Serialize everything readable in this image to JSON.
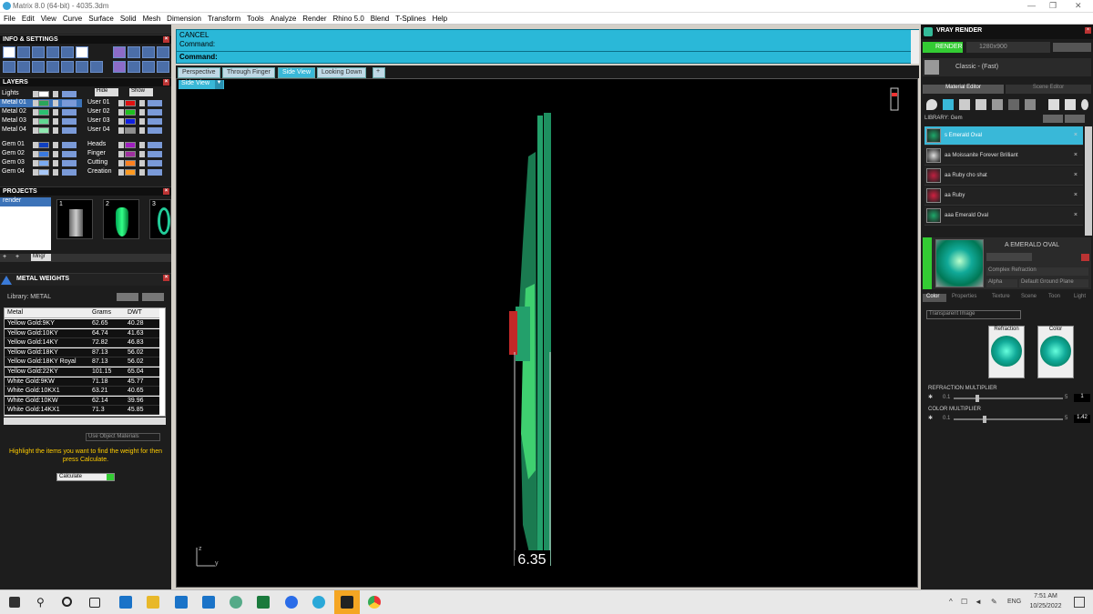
{
  "window": {
    "title": "Matrix 8.0 (64-bit) - 4035.3dm"
  },
  "menu": [
    "File",
    "Edit",
    "View",
    "Curve",
    "Surface",
    "Solid",
    "Mesh",
    "Dimension",
    "Transform",
    "Tools",
    "Analyze",
    "Render",
    "Rhino 5.0",
    "Blend",
    "T-Splines",
    "Help"
  ],
  "left": {
    "info_title": "INFO & SETTINGS",
    "layers_title": "LAYERS",
    "hide_label": "Hide",
    "show_label": "Show",
    "layers_left": [
      {
        "name": "Lights",
        "color": "#ffffff"
      },
      {
        "name": "Metal 01",
        "color": "#2aa55a",
        "selected": true
      },
      {
        "name": "Metal 02",
        "color": "#2ac070"
      },
      {
        "name": "Metal 03",
        "color": "#5fd890"
      },
      {
        "name": "Metal 04",
        "color": "#8fe8b0"
      },
      {
        "name": "Gem 01",
        "color": "#1040c0"
      },
      {
        "name": "Gem 02",
        "color": "#3a7ae0"
      },
      {
        "name": "Gem 03",
        "color": "#7aaaf0"
      },
      {
        "name": "Gem 04",
        "color": "#a8c8f8"
      }
    ],
    "layers_right": [
      {
        "name": "User 01",
        "color": "#e01010"
      },
      {
        "name": "User 02",
        "color": "#20c020"
      },
      {
        "name": "User 03",
        "color": "#1020e0"
      },
      {
        "name": "User 04",
        "color": "#909090"
      },
      {
        "name": "Heads",
        "color": "#a020c0"
      },
      {
        "name": "Finger",
        "color": "#a030a0"
      },
      {
        "name": "Cutting",
        "color": "#ff8020"
      },
      {
        "name": "Creation",
        "color": "#ff9a20"
      }
    ],
    "projects_title": "PROJECTS",
    "project_item": "render",
    "project_nums": [
      "1",
      "2",
      "3"
    ],
    "mngr_label": "Mngr",
    "metal_weights_title": "METAL WEIGHTS",
    "library_label": "Library: METAL",
    "table_headers": [
      "Metal",
      "Grams",
      "DWT"
    ],
    "table_rows": [
      [
        "Yellow Gold:9KY",
        "62.65",
        "40.28"
      ],
      [
        "Yellow Gold:10KY",
        "64.74",
        "41.63"
      ],
      [
        "Yellow Gold:14KY",
        "72.82",
        "46.83"
      ],
      [
        "Yellow Gold:18KY",
        "87.13",
        "56.02"
      ],
      [
        "Yellow Gold:18KY Royal",
        "87.13",
        "56.02"
      ],
      [
        "Yellow Gold:22KY",
        "101.15",
        "65.04"
      ],
      [
        "White Gold:9KW",
        "71.18",
        "45.77"
      ],
      [
        "White Gold:10KX1",
        "63.21",
        "40.65"
      ],
      [
        "White Gold:10KW",
        "62.14",
        "39.96"
      ],
      [
        "White Gold:14KX1",
        "71.3",
        "45.85"
      ]
    ],
    "use_object_materials": "Use Object Materials",
    "hint": "Highlight the items you want to find the weight for then press Calculate.",
    "calculate": "Calculate"
  },
  "command": {
    "line1": "CANCEL",
    "line2": "Command:",
    "line3": "Command:"
  },
  "tabs": [
    "Perspective",
    "Through Finger",
    "Side View",
    "Looking Down",
    "+"
  ],
  "active_tab": "Side View",
  "viewport_label": "Side View",
  "dimension": "6.35",
  "axis": {
    "z": "z",
    "y": "y"
  },
  "right": {
    "title": "VRAY RENDER",
    "render_btn": "RENDER",
    "resolution": "1280x900",
    "style_label": "Classic - (Fast)",
    "tab_material": "Material Editor",
    "tab_scene": "Scene Editor",
    "library_label": "LIBRARY: Gem",
    "materials": [
      {
        "name": "s Emerald Oval",
        "color": "#1da86a",
        "selected": true
      },
      {
        "name": "aa Moissanite Forever Brilliant",
        "color": "#dddddd"
      },
      {
        "name": "aa Ruby cho shat",
        "color": "#c02040"
      },
      {
        "name": "aa Ruby",
        "color": "#d02040"
      },
      {
        "name": "aaa Emerald Oval",
        "color": "#1da86a"
      }
    ],
    "preview_name": "A EMERALD OVAL",
    "complex_refraction": "Complex Refraction",
    "alpha_label": "Alpha",
    "ground_plane": "Default Ground Plane",
    "sub_tabs": [
      "Color",
      "Properties",
      "Texture",
      "Scene",
      "Toon",
      "Light"
    ],
    "transparent": "Transparent Image",
    "refraction_label": "Refraction",
    "color_label": "Color",
    "refraction_multiplier": {
      "label": "REFRACTION MULTIPLIER",
      "min": "0.1",
      "max": "5",
      "value": "1"
    },
    "color_multiplier": {
      "label": "COLOR MULTIPLIER",
      "min": "0.1",
      "max": "5",
      "value": "1.42"
    }
  },
  "taskbar": {
    "time": "7:51 AM",
    "date": "10/25/2022",
    "lang": "ENG"
  }
}
